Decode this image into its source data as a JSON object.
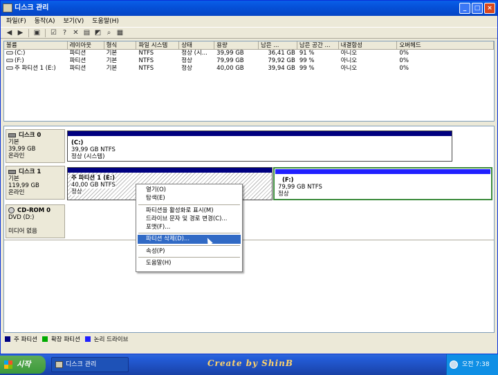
{
  "window": {
    "title": "디스크 관리",
    "controls": [
      "_",
      "□",
      "×"
    ]
  },
  "menu": [
    "파일(F)",
    "동작(A)",
    "보기(V)",
    "도움말(H)"
  ],
  "toolbar_icons": [
    "back-icon",
    "forward-icon",
    "console-icon",
    "properties-icon",
    "help-icon",
    "delete-icon",
    "new-icon",
    "refresh-icon",
    "search-icon",
    "settings-icon"
  ],
  "volume_list": {
    "columns": [
      "볼륨",
      "레이아웃",
      "형식",
      "파일 시스템",
      "상태",
      "용량",
      "남은 ...",
      "남은 공간 ...",
      "내결함성",
      "오버헤드"
    ],
    "rows": [
      [
        "(C:)",
        "파티션",
        "기본",
        "NTFS",
        "정상 (시...",
        "39,99 GB",
        "36,41 GB",
        "91 %",
        "아니오",
        "0%"
      ],
      [
        "(F:)",
        "파티션",
        "기본",
        "NTFS",
        "정상",
        "79,99 GB",
        "79,92 GB",
        "99 %",
        "아니오",
        "0%"
      ],
      [
        "주 파티션 1 (E:)",
        "파티션",
        "기본",
        "NTFS",
        "정상",
        "40,00 GB",
        "39,94 GB",
        "99 %",
        "아니오",
        "0%"
      ]
    ]
  },
  "disks": [
    {
      "name": "디스크 0",
      "type": "기본",
      "size": "39,99 GB",
      "status": "온라인"
    },
    {
      "name": "디스크 1",
      "type": "기본",
      "size": "119,99 GB",
      "status": "온라인"
    },
    {
      "name": "CD-ROM 0",
      "type": "DVD (D:)",
      "size": "",
      "status": "미디어 없음"
    }
  ],
  "partitions": {
    "c": {
      "title": "(C:)",
      "size": "39,99 GB NTFS",
      "status": "정상 (시스템)"
    },
    "e": {
      "title": "주 파티션 1  (E:)",
      "size": "40,00 GB NTFS",
      "status": "정상"
    },
    "f": {
      "title": "(F:)",
      "size": "79,99 GB NTFS",
      "status": "정상"
    }
  },
  "context_menu": {
    "items": [
      "열기(O)",
      "탐색(E)",
      "파티션을 활성화로 표시(M)",
      "드라이브 문자 및 경로 변경(C)...",
      "포맷(F)...",
      "파티션 삭제(D)...",
      "속성(P)",
      "도움말(H)"
    ],
    "highlighted": "파티션 삭제(D)..."
  },
  "legend": [
    "주 파티션",
    "확장 파티션",
    "논리 드라이브"
  ],
  "colors": {
    "primary": "#000080",
    "extended": "#00aa00",
    "logical": "#2020ff",
    "highlight": "#316ac5"
  },
  "taskbar": {
    "start": "시작",
    "task": "디스크 관리",
    "brand": "Create by ShinB",
    "clock": "오전 7:38"
  }
}
